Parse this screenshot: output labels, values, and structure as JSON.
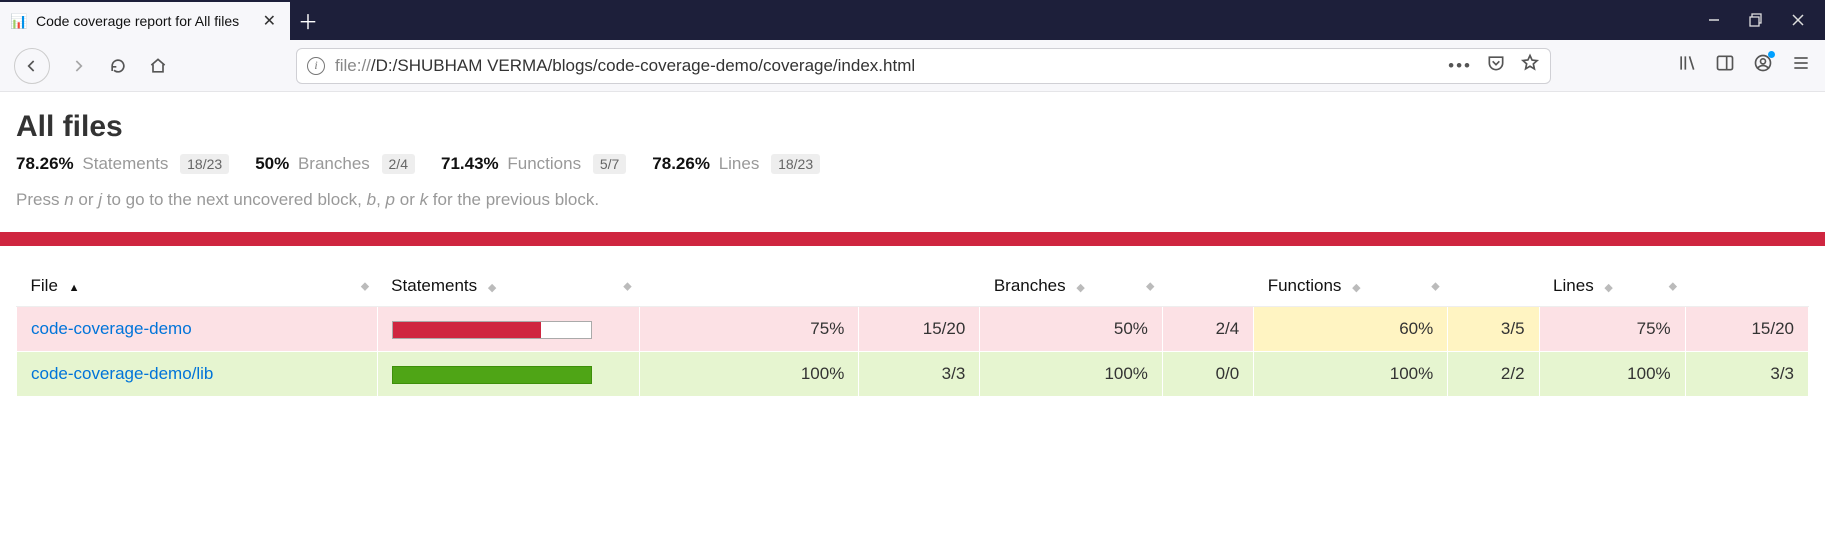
{
  "browser": {
    "tab_title": "Code coverage report for All files",
    "url_protocol": "file://",
    "url_path": "/D:/SHUBHAM VERMA/blogs/code-coverage-demo/coverage/index.html"
  },
  "page": {
    "title": "All files",
    "summary": {
      "statements": {
        "pct": "78.26%",
        "label": "Statements",
        "fraction": "18/23"
      },
      "branches": {
        "pct": "50%",
        "label": "Branches",
        "fraction": "2/4"
      },
      "functions": {
        "pct": "71.43%",
        "label": "Functions",
        "fraction": "5/7"
      },
      "lines": {
        "pct": "78.26%",
        "label": "Lines",
        "fraction": "18/23"
      }
    },
    "help_prefix": "Press ",
    "help_key1": "n",
    "help_mid1": " or ",
    "help_key2": "j",
    "help_mid2": " to go to the next uncovered block, ",
    "help_key3": "b",
    "help_mid3": ", ",
    "help_key4": "p",
    "help_mid4": " or ",
    "help_key5": "k",
    "help_suffix": " for the previous block."
  },
  "table": {
    "headers": {
      "file": "File",
      "statements": "Statements",
      "branches": "Branches",
      "functions": "Functions",
      "lines": "Lines"
    },
    "rows": [
      {
        "name": "code-coverage-demo",
        "statements_pct": "75%",
        "statements_fraction": "15/20",
        "branches_pct": "50%",
        "branches_fraction": "2/4",
        "functions_pct": "60%",
        "functions_fraction": "3/5",
        "lines_pct": "75%",
        "lines_fraction": "15/20"
      },
      {
        "name": "code-coverage-demo/lib",
        "statements_pct": "100%",
        "statements_fraction": "3/3",
        "branches_pct": "100%",
        "branches_fraction": "0/0",
        "functions_pct": "100%",
        "functions_fraction": "2/2",
        "lines_pct": "100%",
        "lines_fraction": "3/3"
      }
    ]
  },
  "chart_data": {
    "type": "bar",
    "title": "Statement coverage per file",
    "xlabel": "",
    "ylabel": "",
    "ylim": [
      0,
      100
    ],
    "categories": [
      "code-coverage-demo",
      "code-coverage-demo/lib"
    ],
    "values": [
      75,
      100
    ]
  }
}
